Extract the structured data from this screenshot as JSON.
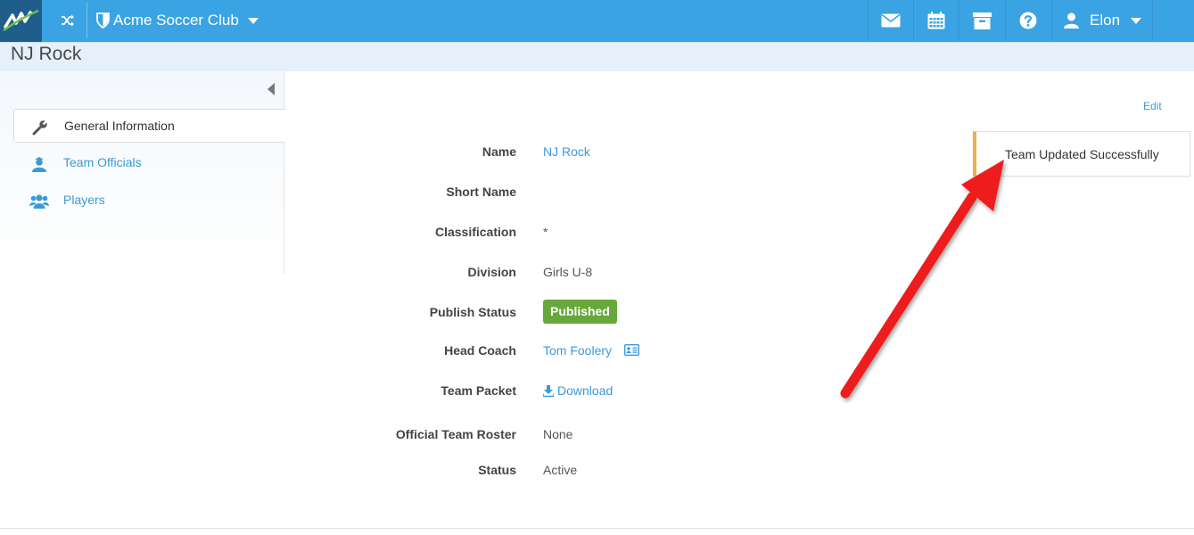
{
  "navbar": {
    "org_name": "Acme Soccer Club",
    "user_name": "Elon",
    "icons": [
      "shuffle-icon",
      "shield-icon",
      "envelope-icon",
      "calendar-icon",
      "archive-icon",
      "help-icon",
      "user-icon"
    ],
    "color": "#3aa3e3"
  },
  "page": {
    "title": "NJ Rock"
  },
  "sidebar": {
    "items": [
      {
        "label": "General Information",
        "icon": "wrench-icon",
        "active": true
      },
      {
        "label": "Team Officials",
        "icon": "official-icon",
        "active": false
      },
      {
        "label": "Players",
        "icon": "users-icon",
        "active": false
      }
    ]
  },
  "details": {
    "edit_label": "Edit",
    "fields": [
      {
        "label": "Name",
        "value": "NJ Rock"
      },
      {
        "label": "Short Name",
        "value": ""
      },
      {
        "label": "Classification",
        "value": "*"
      },
      {
        "label": "Division",
        "value": "Girls U-8"
      },
      {
        "label": "Publish Status",
        "value": "Published"
      },
      {
        "label": "Head Coach",
        "value": "Tom Foolery"
      },
      {
        "label": "Team Packet",
        "value": "Download"
      },
      {
        "label": "Official Team Roster",
        "value": "None"
      },
      {
        "label": "Status",
        "value": "Active"
      }
    ]
  },
  "toast": {
    "message": "Team Updated Successfully",
    "accent": "#f0ad4e"
  },
  "annotation": {
    "arrow_color": "#ee1c1c"
  }
}
